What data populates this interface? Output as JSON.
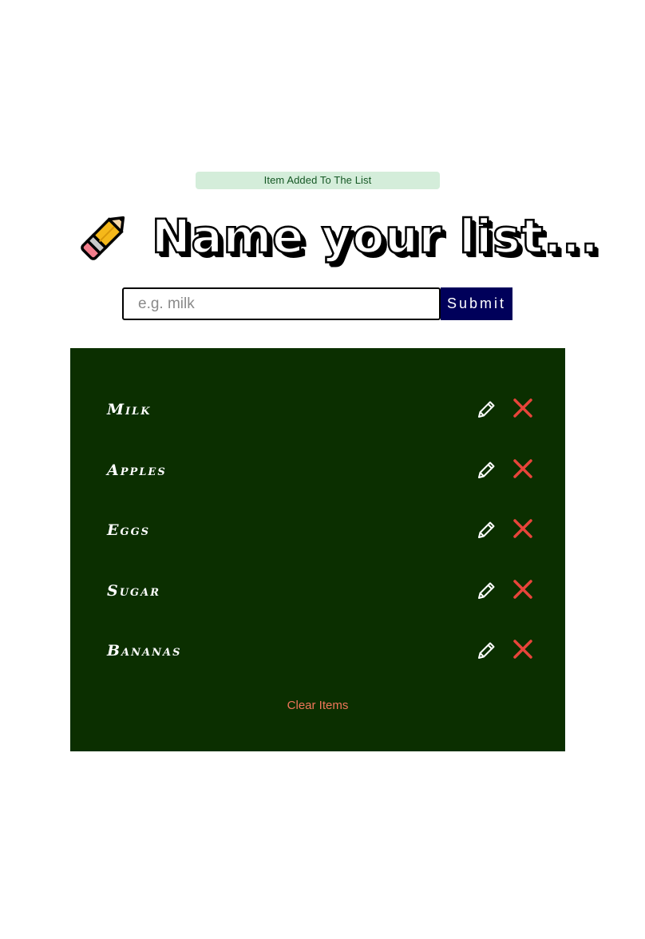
{
  "alert": {
    "text": "Item Added To The List",
    "color": "#155724",
    "background": "#d4edda"
  },
  "header": {
    "title": "Name your list...",
    "icon": "pencil-icon"
  },
  "form": {
    "placeholder": "e.g. milk",
    "value": "",
    "submit_label": "Submit",
    "submit_color": "#00005a"
  },
  "list": {
    "background": "#0b2f00",
    "items": [
      {
        "name": "Milk"
      },
      {
        "name": "Apples"
      },
      {
        "name": "Eggs"
      },
      {
        "name": "Sugar"
      },
      {
        "name": "Bananas"
      }
    ],
    "edit_icon": "edit-pencil-icon",
    "delete_icon": "close-icon",
    "clear_label": "Clear Items",
    "clear_color": "#f0765a",
    "delete_color": "#e8443a"
  }
}
